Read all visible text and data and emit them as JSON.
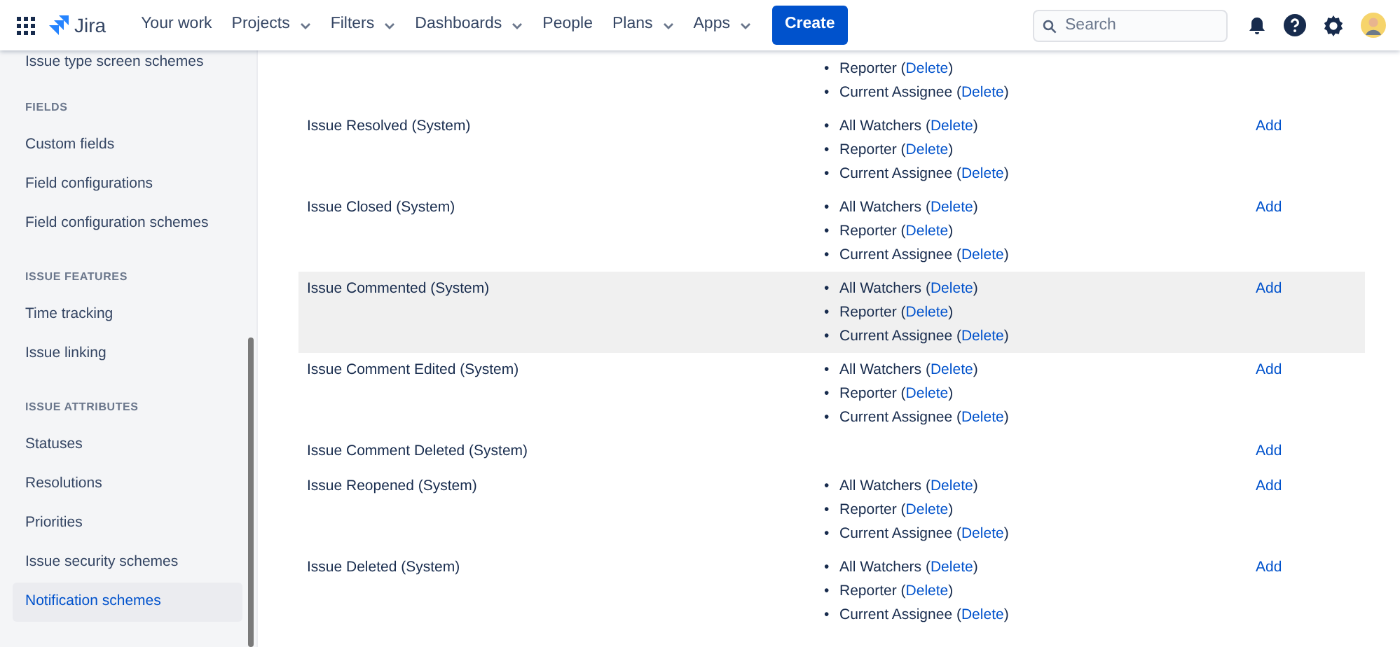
{
  "header": {
    "product": "Jira",
    "nav": [
      {
        "label": "Your work",
        "dropdown": false
      },
      {
        "label": "Projects",
        "dropdown": true
      },
      {
        "label": "Filters",
        "dropdown": true
      },
      {
        "label": "Dashboards",
        "dropdown": true
      },
      {
        "label": "People",
        "dropdown": false
      },
      {
        "label": "Plans",
        "dropdown": true
      },
      {
        "label": "Apps",
        "dropdown": true
      }
    ],
    "create": "Create",
    "search": {
      "placeholder": "Search"
    }
  },
  "sidebar": {
    "sections": [
      {
        "items": [
          {
            "label": "Issue type screen schemes",
            "selected": false
          }
        ]
      },
      {
        "title": "FIELDS",
        "items": [
          {
            "label": "Custom fields",
            "selected": false
          },
          {
            "label": "Field configurations",
            "selected": false
          },
          {
            "label": "Field configuration schemes",
            "selected": false
          }
        ]
      },
      {
        "title": "ISSUE FEATURES",
        "items": [
          {
            "label": "Time tracking",
            "selected": false
          },
          {
            "label": "Issue linking",
            "selected": false
          }
        ]
      },
      {
        "title": "ISSUE ATTRIBUTES",
        "items": [
          {
            "label": "Statuses",
            "selected": false
          },
          {
            "label": "Resolutions",
            "selected": false
          },
          {
            "label": "Priorities",
            "selected": false
          },
          {
            "label": "Issue security schemes",
            "selected": false
          },
          {
            "label": "Notification schemes",
            "selected": true
          }
        ]
      }
    ]
  },
  "events": [
    {
      "recipients": [
        {
          "bullet": "•",
          "name": "Reporter (",
          "action": "Delete",
          "tail": ")"
        },
        {
          "bullet": "•",
          "name": "Current Assignee (",
          "action": "Delete",
          "tail": ")"
        }
      ],
      "highlighted": false
    },
    {
      "name": "Issue Resolved (System)",
      "recipients": [
        {
          "bullet": "•",
          "name": "All Watchers (",
          "action": "Delete",
          "tail": ")"
        },
        {
          "bullet": "•",
          "name": "Reporter (",
          "action": "Delete",
          "tail": ")"
        },
        {
          "bullet": "•",
          "name": "Current Assignee (",
          "action": "Delete",
          "tail": ")"
        }
      ],
      "add": "Add",
      "highlighted": false
    },
    {
      "name": "Issue Closed (System)",
      "recipients": [
        {
          "bullet": "•",
          "name": "All Watchers (",
          "action": "Delete",
          "tail": ")"
        },
        {
          "bullet": "•",
          "name": "Reporter (",
          "action": "Delete",
          "tail": ")"
        },
        {
          "bullet": "•",
          "name": "Current Assignee (",
          "action": "Delete",
          "tail": ")"
        }
      ],
      "add": "Add",
      "highlighted": false
    },
    {
      "name": "Issue Commented (System)",
      "recipients": [
        {
          "bullet": "•",
          "name": "All Watchers (",
          "action": "Delete",
          "tail": ")"
        },
        {
          "bullet": "•",
          "name": "Reporter (",
          "action": "Delete",
          "tail": ")"
        },
        {
          "bullet": "•",
          "name": "Current Assignee (",
          "action": "Delete",
          "tail": ")"
        }
      ],
      "add": "Add",
      "highlighted": true
    },
    {
      "name": "Issue Comment Edited (System)",
      "recipients": [
        {
          "bullet": "•",
          "name": "All Watchers (",
          "action": "Delete",
          "tail": ")"
        },
        {
          "bullet": "•",
          "name": "Reporter (",
          "action": "Delete",
          "tail": ")"
        },
        {
          "bullet": "•",
          "name": "Current Assignee (",
          "action": "Delete",
          "tail": ")"
        }
      ],
      "add": "Add",
      "highlighted": false
    },
    {
      "name": "Issue Comment Deleted (System)",
      "add": "Add",
      "highlighted": false
    },
    {
      "name": "Issue Reopened (System)",
      "recipients": [
        {
          "bullet": "•",
          "name": "All Watchers (",
          "action": "Delete",
          "tail": ")"
        },
        {
          "bullet": "•",
          "name": "Reporter (",
          "action": "Delete",
          "tail": ")"
        },
        {
          "bullet": "•",
          "name": "Current Assignee (",
          "action": "Delete",
          "tail": ")"
        }
      ],
      "add": "Add",
      "highlighted": false
    },
    {
      "name": "Issue Deleted (System)",
      "recipients": [
        {
          "bullet": "•",
          "name": "All Watchers (",
          "action": "Delete",
          "tail": ")"
        },
        {
          "bullet": "•",
          "name": "Reporter (",
          "action": "Delete",
          "tail": ")"
        },
        {
          "bullet": "•",
          "name": "Current Assignee (",
          "action": "Delete",
          "tail": ")"
        }
      ],
      "add": "Add",
      "highlighted": false
    }
  ]
}
